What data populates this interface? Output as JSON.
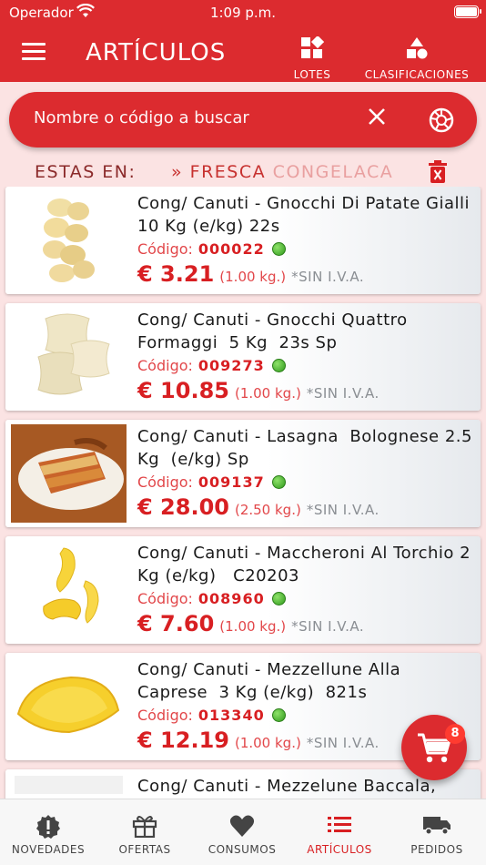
{
  "status_bar": {
    "carrier": "Operador",
    "time": "1:09 p.m."
  },
  "header": {
    "title": "ARTÍCULOS",
    "lotes_label": "LOTES",
    "clasificaciones_label": "CLASIFICACIONES"
  },
  "search": {
    "placeholder": "Nombre o código a buscar"
  },
  "filter": {
    "label": "ESTAS EN:",
    "path": "» FRESCA ",
    "path_faded": "CONGELACA"
  },
  "products": [
    {
      "name": "Cong/ Canuti - Gnocchi Di Patate Gialli  10 Kg (e/kg) 22s",
      "code_label": "Código:",
      "code": "000022",
      "price": "€ 3.21",
      "unit": "(1.00 kg.)",
      "tax": "*SIN I.V.A.",
      "image": "gnocchi-patate"
    },
    {
      "name": "Cong/ Canuti - Gnocchi Quattro Formaggi  5 Kg  23s Sp",
      "code_label": "Código:",
      "code": "009273",
      "price": "€ 10.85",
      "unit": "(1.00 kg.)",
      "tax": "*SIN I.V.A.",
      "image": "gnocchi-formaggi"
    },
    {
      "name": "Cong/ Canuti - Lasagna  Bolognese 2.5 Kg  (e/kg) Sp",
      "code_label": "Código:",
      "code": "009137",
      "price": "€ 28.00",
      "unit": "(2.50 kg.)",
      "tax": "*SIN I.V.A.",
      "image": "lasagna"
    },
    {
      "name": "Cong/ Canuti - Maccheroni Al Torchio 2 Kg (e/kg)   C20203",
      "code_label": "Código:",
      "code": "008960",
      "price": "€ 7.60",
      "unit": "(1.00 kg.)",
      "tax": "*SIN I.V.A.",
      "image": "maccheroni"
    },
    {
      "name": "Cong/ Canuti - Mezzellune Alla Caprese  3 Kg (e/kg)  821s",
      "code_label": "Código:",
      "code": "013340",
      "price": "€ 12.19",
      "unit": "(1.00 kg.)",
      "tax": "*SIN I.V.A.",
      "image": "mezzellune"
    },
    {
      "name": "Cong/ Canuti - Mezzelune Baccala,",
      "code_label": "",
      "code": "",
      "price": "",
      "unit": "",
      "tax": "",
      "image": "mezzelune-baccala"
    }
  ],
  "cart": {
    "count": "8"
  },
  "bottom_nav": [
    {
      "label": "NOVEDADES",
      "icon": "alert-badge-icon",
      "active": false
    },
    {
      "label": "OFERTAS",
      "icon": "gift-icon",
      "active": false
    },
    {
      "label": "CONSUMOS",
      "icon": "heart-icon",
      "active": false
    },
    {
      "label": "ARTÍCULOS",
      "icon": "list-icon",
      "active": true
    },
    {
      "label": "PEDIDOS",
      "icon": "truck-icon",
      "active": false
    }
  ],
  "colors": {
    "primary": "#dc2b2f",
    "background": "#fbe3e3",
    "accent_text": "#d81f22",
    "available": "#3fae2a"
  }
}
